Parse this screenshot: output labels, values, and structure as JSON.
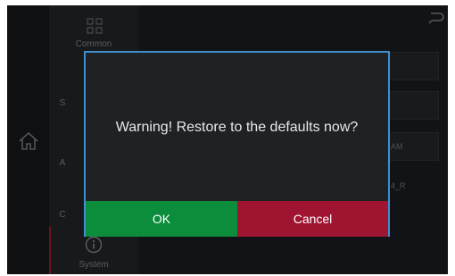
{
  "sidebar": {
    "items": [
      {
        "label": "Common",
        "icon": "grid-icon"
      },
      {
        "label": "S",
        "icon": ""
      },
      {
        "label": "A",
        "icon": ""
      },
      {
        "label": "C",
        "icon": ""
      },
      {
        "label": "System",
        "icon": "info-icon"
      }
    ]
  },
  "background_rows": {
    "am_text": "AM",
    "code_text": "4_R"
  },
  "dialog": {
    "message": "Warning! Restore to the defaults now?",
    "ok_label": "OK",
    "cancel_label": "Cancel"
  },
  "colors": {
    "ok": "#0b8d3b",
    "cancel": "#9f1431",
    "dialog_border": "#3f8fd0"
  }
}
